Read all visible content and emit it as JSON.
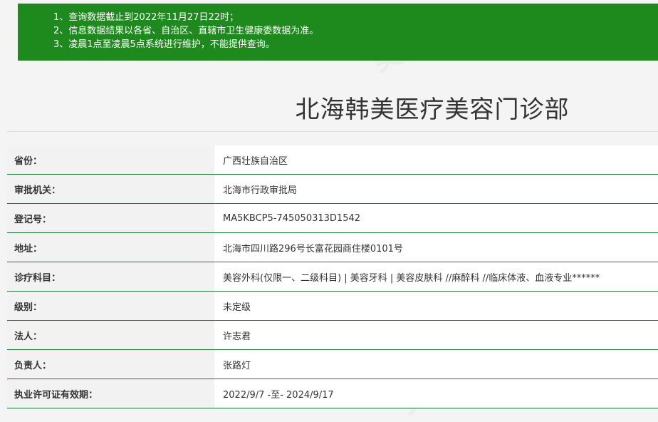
{
  "notice": {
    "lines": [
      "1、查询数据截止到2022年11月27日22时；",
      "2、信息数据结果以各省、自治区、直辖市卫生健康委数据为准。",
      "3、凌晨1点至凌晨5点系统进行维护，不能提供查询。"
    ]
  },
  "title": "北海韩美医疗美容门诊部",
  "rows": [
    {
      "label": "省份：",
      "value": "广西壮族自治区"
    },
    {
      "label": "审批机关：",
      "value": "北海市行政审批局"
    },
    {
      "label": "登记号：",
      "value": "MA5KBCP5-745050313D1542"
    },
    {
      "label": "地址：",
      "value": "北海市四川路296号长富花园商住楼0101号"
    },
    {
      "label": "诊疗科目：",
      "value": "美容外科(仅限一、二级科目) | 美容牙科 | 美容皮肤科 //麻醉科 //临床体液、血液专业******"
    },
    {
      "label": "级别：",
      "value": "未定级"
    },
    {
      "label": "法人：",
      "value": "许志君"
    },
    {
      "label": "负责人：",
      "value": "张路灯"
    },
    {
      "label": "执业许可证有效期：",
      "value": "2022/9/7 -至- 2024/9/17"
    }
  ],
  "watermark": {
    "text": "美佳"
  },
  "colors": {
    "notice_bg": "#1e8a1e",
    "row_border": "#1f7a3a"
  }
}
